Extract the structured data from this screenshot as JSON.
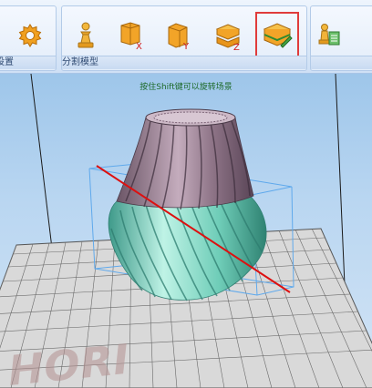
{
  "ribbon": {
    "groups": [
      {
        "label": "设置"
      },
      {
        "label": "分割模型"
      }
    ],
    "buttons": [
      {
        "name": "settings-gear-icon"
      },
      {
        "name": "chess-pawn-icon"
      },
      {
        "name": "cut-x-icon",
        "axis": "X"
      },
      {
        "name": "cut-y-icon",
        "axis": "Y"
      },
      {
        "name": "cut-z-icon",
        "axis": "Z"
      },
      {
        "name": "cut-free-plane-icon",
        "selected": true
      },
      {
        "name": "pawn-document-icon"
      }
    ]
  },
  "viewport": {
    "hint": "按住Shift键可以旋转场景",
    "watermark": "HORI",
    "accent_color": "#e03b3b",
    "axis_line_color": "#dd1010",
    "bbox_color": "#5fa9ec"
  }
}
